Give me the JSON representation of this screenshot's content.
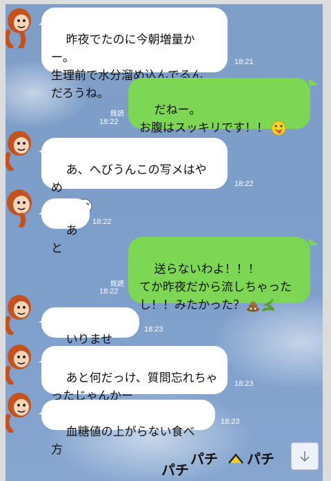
{
  "messages": [
    {
      "side": "in",
      "text": "昨夜でたのに今朝増量かー。\n生理前で水分溜め込んでるん\nだろうね。",
      "time": "18:21"
    },
    {
      "side": "out",
      "text": "だねー。\nお腹はスッキリです！！",
      "read": "既読",
      "time": "18:22"
    },
    {
      "side": "in",
      "text": "あ、へびうんこの写メはやめ\nてね",
      "time": "18:22"
    },
    {
      "side": "in",
      "text": "あと",
      "time": "18:22"
    },
    {
      "side": "out",
      "text": "送らないわよ！！！\nてか昨夜だから流しちゃった\nし！！みたかった？",
      "read": "既読",
      "time": "18:22"
    },
    {
      "side": "in",
      "text": "いりません！",
      "time": "18:23"
    },
    {
      "side": "in",
      "text": "あと何だっけ、質問忘れちゃ\nったじゃんかー",
      "time": "18:23"
    },
    {
      "side": "in",
      "text": "血糖値の上がらない食べ方",
      "time": "18:23"
    }
  ],
  "sticker_text": [
    "パチ",
    "パチ",
    "パチ"
  ],
  "icons": {
    "emoji_1": "tongue-face-icon",
    "emoji_2": "sweat-face-icon",
    "emoji_3": "poop-icon",
    "emoji_4": "snake-icon",
    "scroll": "arrow-down-icon",
    "avatar": "monkey-avatar-icon"
  },
  "colors": {
    "incoming": "#ffffff",
    "outgoing": "#7dd754",
    "background": "#7f9fc8"
  }
}
